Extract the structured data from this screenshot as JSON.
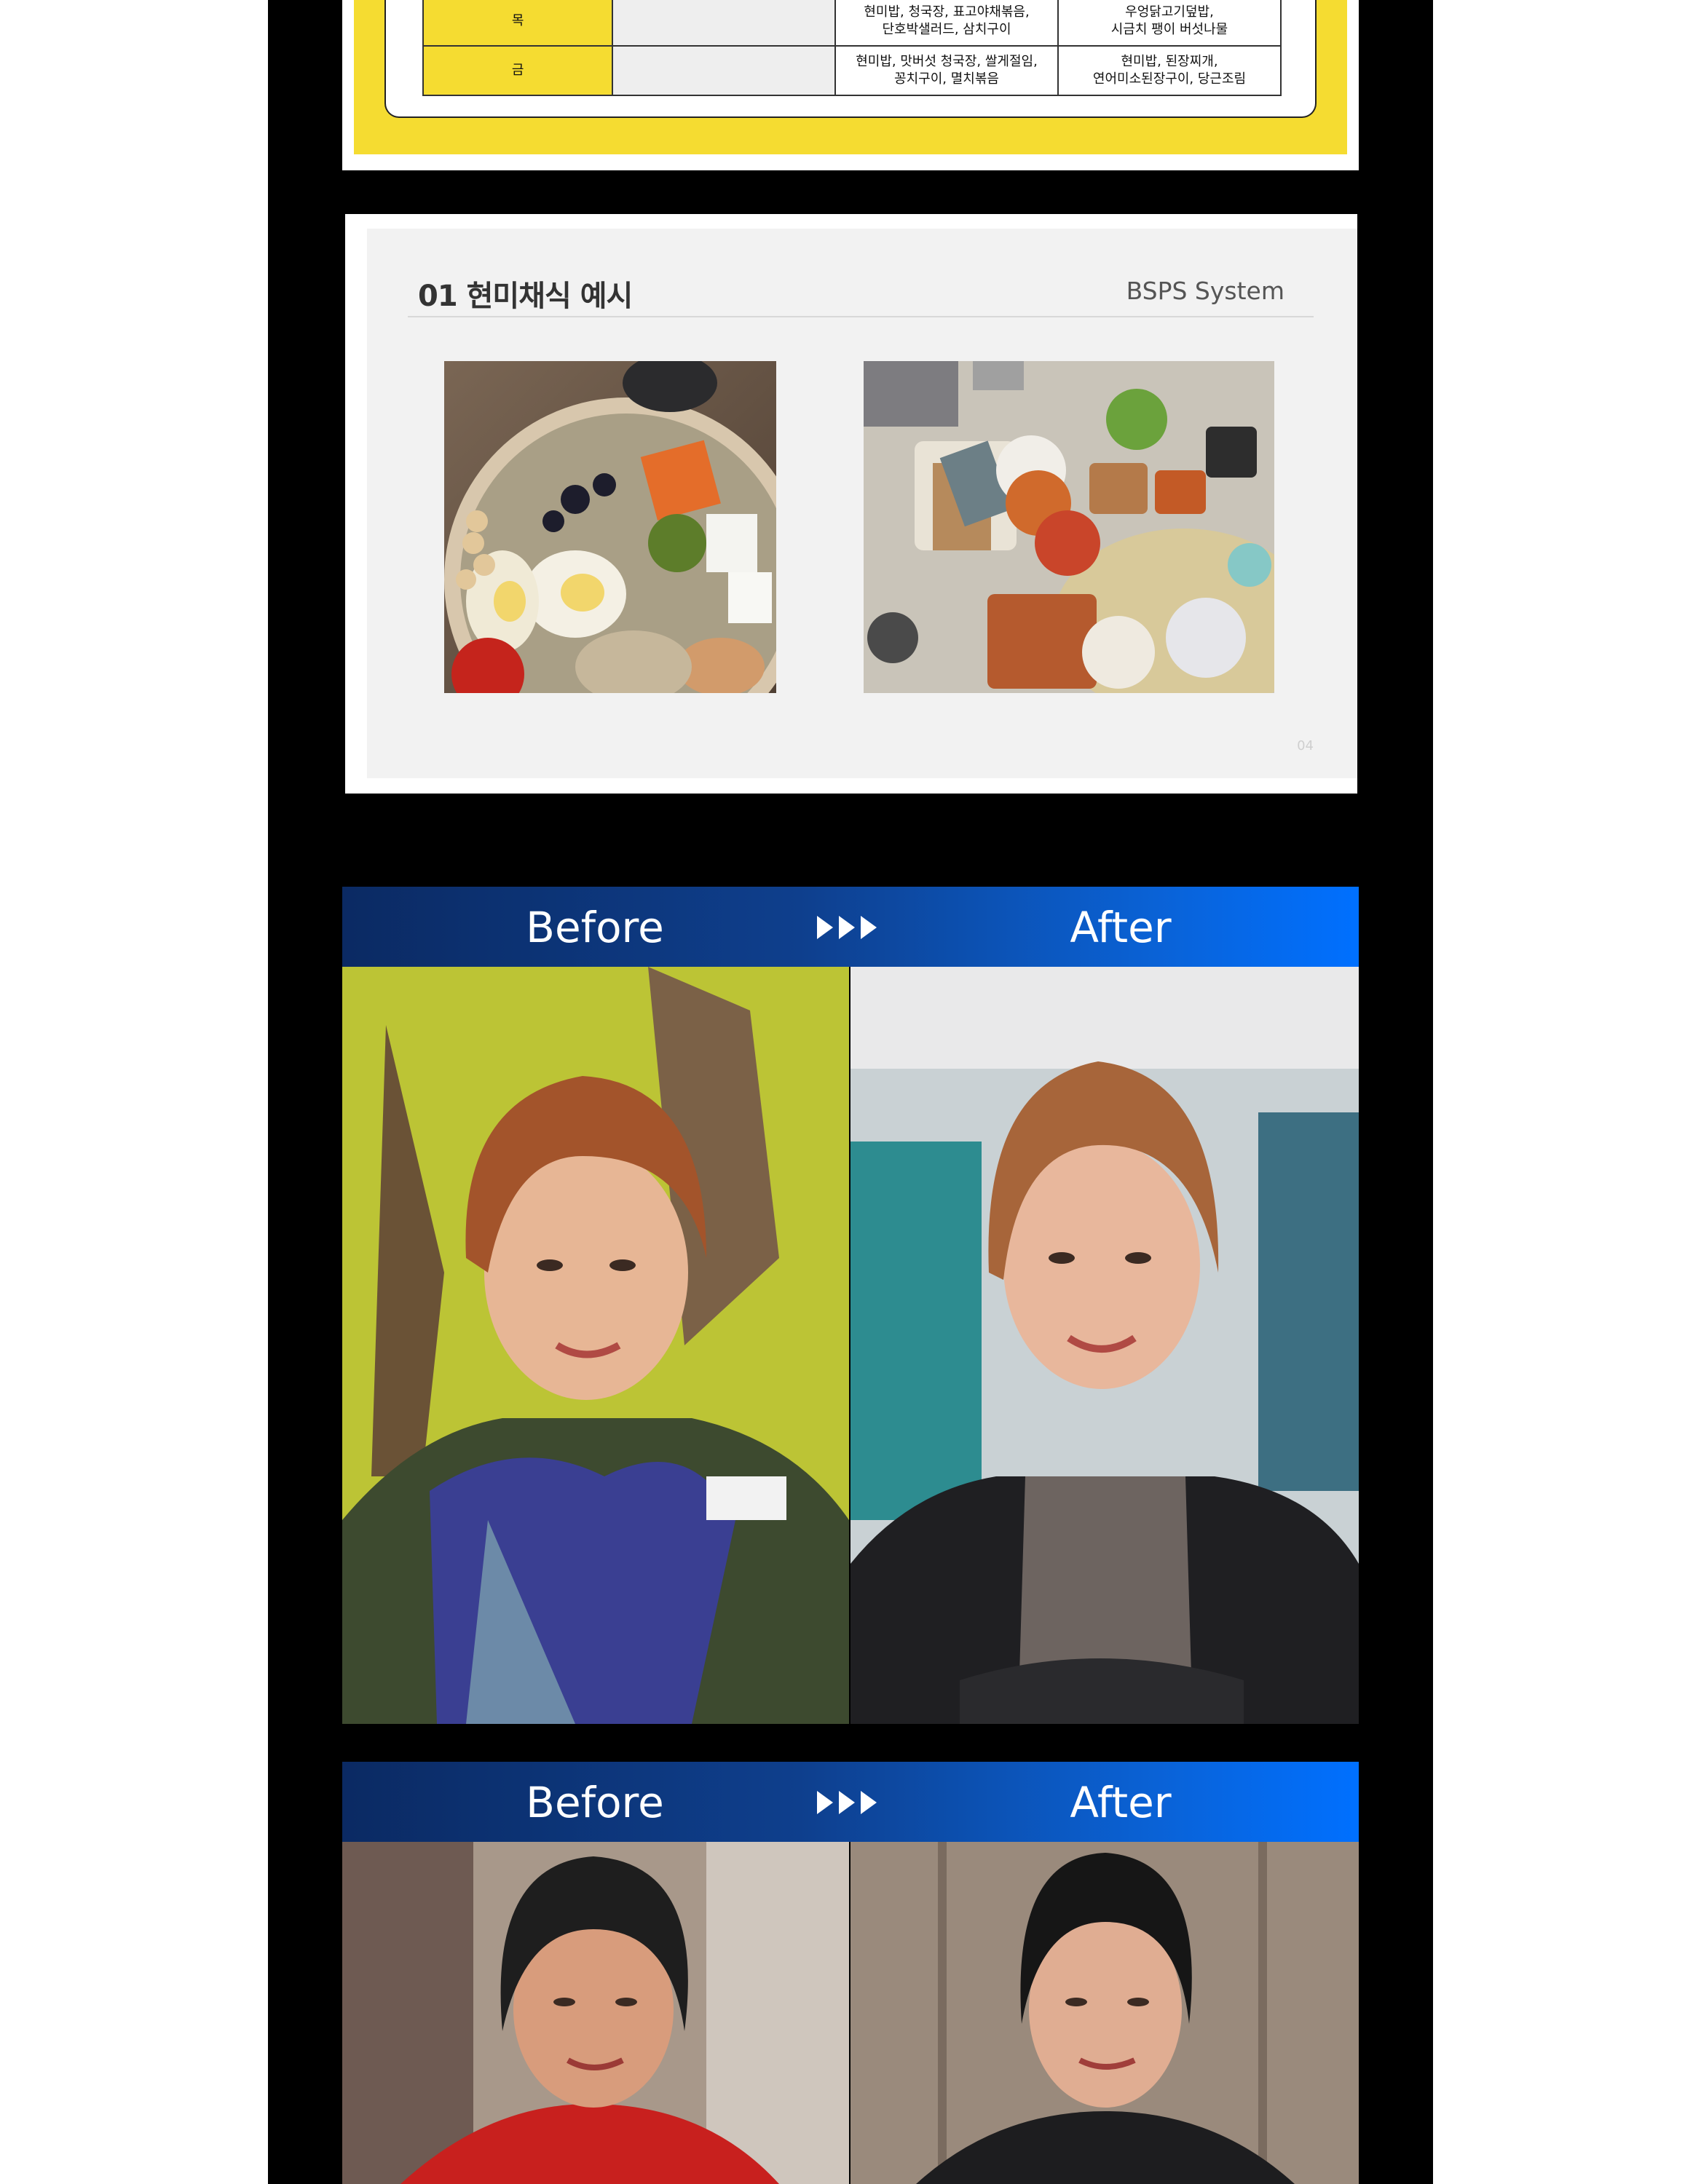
{
  "meal_table": {
    "rows": [
      {
        "day": "목",
        "menu_a": "현미밥, 청국장, 표고야채볶음,\n단호박샐러드, 삼치구이",
        "menu_b": "우엉닭고기덮밥,\n시금치 팽이 버섯나물"
      },
      {
        "day": "금",
        "menu_a": "현미밥, 맛버섯 청국장, 쌀게절임,\n꽁치구이, 멸치볶음",
        "menu_b": "현미밥, 된장찌개,\n연어미소된장구이, 당근조림"
      }
    ]
  },
  "slide": {
    "title": "01 현미채식 예시",
    "brand": "BSPS System",
    "page_number": "04",
    "photos": [
      "salad-bowl-photo",
      "korean-table-meal-photo"
    ]
  },
  "comparisons": [
    {
      "before_label": "Before",
      "after_label": "After",
      "arrows": "▶▶▶"
    },
    {
      "before_label": "Before",
      "after_label": "After",
      "arrows": "▶▶▶"
    }
  ],
  "colors": {
    "yellow": "#f5dc31",
    "header_blue_dark": "#0b2a63",
    "header_blue_light": "#0070ff",
    "background": "#000000"
  }
}
